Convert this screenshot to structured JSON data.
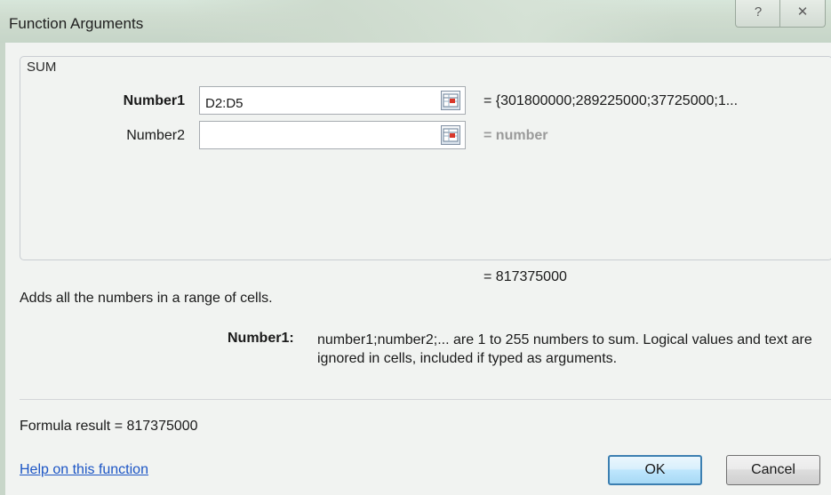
{
  "window": {
    "title": "Function Arguments",
    "help_glyph": "?",
    "close_glyph": "✕"
  },
  "function": {
    "name": "SUM",
    "args": [
      {
        "label": "Number1",
        "value": "D2:D5",
        "result": "= {301800000;289225000;37725000;1..."
      },
      {
        "label": "Number2",
        "value": "",
        "result": "= number"
      }
    ],
    "result": "= 817375000",
    "description": "Adds all the numbers in a range of cells.",
    "arg_help_label": "Number1:",
    "arg_help_text": "number1;number2;... are 1 to 255 numbers to sum. Logical values and text are ignored in cells, included if typed as arguments.",
    "formula_result": "Formula result =   817375000",
    "help_link": "Help on this function"
  },
  "buttons": {
    "ok": "OK",
    "cancel": "Cancel"
  },
  "colors": {
    "link": "#1c55c5",
    "ok_border": "#3c7fb1"
  }
}
